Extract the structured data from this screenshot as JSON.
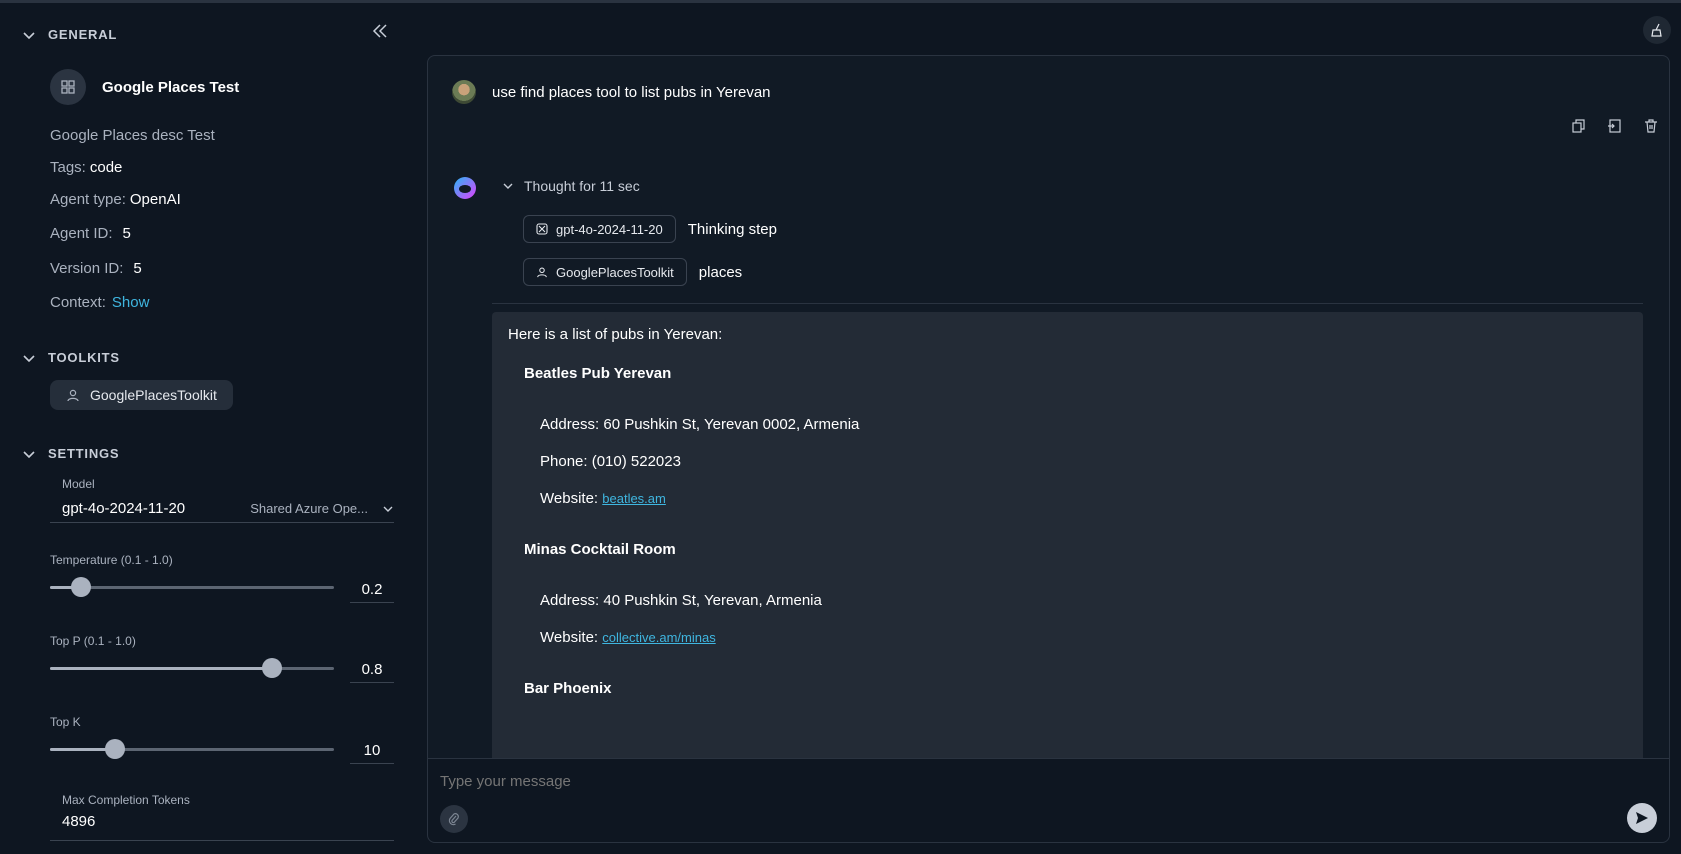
{
  "sidebar": {
    "sections": {
      "general": "GENERAL",
      "toolkits": "TOOLKITS",
      "settings": "SETTINGS"
    },
    "agent": {
      "name": "Google Places Test",
      "description": "Google Places desc Test",
      "tags_label": "Tags:",
      "tags_value": "code",
      "type_label": "Agent type:",
      "type_value": "OpenAI",
      "id_label": "Agent ID:",
      "id_value": "5",
      "version_label": "Version ID:",
      "version_value": "5",
      "context_label": "Context:",
      "context_link": "Show"
    },
    "toolkit": "GooglePlacesToolkit",
    "settings": {
      "model_label": "Model",
      "model_value": "gpt-4o-2024-11-20",
      "provider_value": "Shared Azure Ope...",
      "temperature_label": "Temperature (0.1 - 1.0)",
      "temperature_value": "0.2",
      "temperature_fraction": 0.11,
      "top_p_label": "Top P (0.1 - 1.0)",
      "top_p_value": "0.8",
      "top_p_fraction": 0.78,
      "top_k_label": "Top K",
      "top_k_value": "10",
      "top_k_fraction": 0.23,
      "max_tokens_label": "Max Completion Tokens",
      "max_tokens_value": "4896"
    }
  },
  "chat": {
    "user_message": "use find places tool to list pubs in Yerevan",
    "thought": "Thought for 11 sec",
    "steps": [
      {
        "chip": "gpt-4o-2024-11-20",
        "text": "Thinking step",
        "icon": "model-icon"
      },
      {
        "chip": "GooglePlacesToolkit",
        "text": "places",
        "icon": "toolkit-icon"
      }
    ],
    "answer": {
      "intro": "Here is a list of pubs in Yerevan:",
      "pubs": [
        {
          "name": "Beatles Pub Yerevan",
          "address": "Address: 60 Pushkin St, Yerevan 0002, Armenia",
          "phone": "Phone: (010) 522023",
          "website_label": "Website:",
          "website": "beatles.am"
        },
        {
          "name": "Minas Cocktail Room",
          "address": "Address: 40 Pushkin St, Yerevan, Armenia",
          "website_label": "Website:",
          "website": "collective.am/minas"
        },
        {
          "name": "Bar Phoenix"
        }
      ]
    },
    "input_placeholder": "Type your message"
  }
}
